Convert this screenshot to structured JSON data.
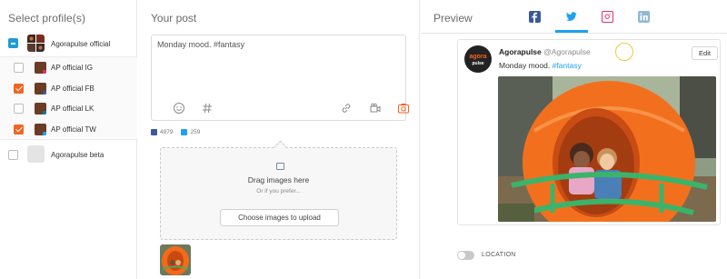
{
  "profiles": {
    "header": "Select profile(s)",
    "group": {
      "label": "Agorapulse official",
      "state": "partial"
    },
    "items": [
      {
        "label": "AP official IG",
        "checked": false,
        "network": "instagram-icon"
      },
      {
        "label": "AP official FB",
        "checked": true,
        "network": "facebook-icon"
      },
      {
        "label": "AP official LK",
        "checked": false,
        "network": "linkedin-icon"
      },
      {
        "label": "AP official TW",
        "checked": true,
        "network": "twitter-icon"
      }
    ],
    "other": {
      "label": "Agorapulse beta",
      "checked": false
    }
  },
  "post": {
    "header": "Your post",
    "text": "Monday mood. #fantasy",
    "tools": [
      "emoji-icon",
      "hashtag-icon",
      "link-icon",
      "video-icon",
      "camera-icon"
    ],
    "counts": [
      {
        "network": "facebook-icon",
        "value": "4979"
      },
      {
        "network": "twitter-icon",
        "value": "259"
      }
    ],
    "dropzone": {
      "title": "Drag images here",
      "subtitle": "Or if you prefer...",
      "button": "Choose images to upload"
    }
  },
  "preview": {
    "header": "Preview",
    "tabs": [
      "facebook-icon",
      "twitter-icon",
      "instagram-icon",
      "linkedin-icon"
    ],
    "active_tab": "twitter-icon",
    "tweet": {
      "avatar_text_top": "agora",
      "avatar_text_bottom": "pulse",
      "name": "Agorapulse",
      "handle": "@Agorapulse",
      "text_plain": "Monday mood. ",
      "text_tag": "#fantasy",
      "edit_label": "Edit"
    },
    "location_label": "LOCATION"
  },
  "colors": {
    "accent_orange": "#f26522",
    "twitter_blue": "#1da1f2",
    "facebook_blue": "#3b5998",
    "instagram_pink": "#e1306c",
    "linkedin_blue": "#0077b5"
  }
}
